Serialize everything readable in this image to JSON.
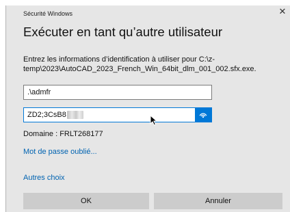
{
  "window": {
    "title": "Sécurité Windows",
    "close_glyph": "✕"
  },
  "dialog": {
    "heading": "Exécuter en tant qu’autre utilisateur",
    "description": "Entrez les informations d’identification à utiliser pour C:\\z-temp\\2023\\AutoCAD_2023_French_Win_64bit_dlm_001_002.sfx.exe."
  },
  "username_field": {
    "value": ".\\admfr"
  },
  "password_field": {
    "visible_value": "ZD2;3CsB8",
    "reveal_icon": "eye-reveal-icon"
  },
  "domain": {
    "text": "Domaine : FRLT268177"
  },
  "links": {
    "forgot_password": "Mot de passe oublié...",
    "more_choices": "Autres choix"
  },
  "buttons": {
    "ok": "OK",
    "cancel": "Annuler"
  },
  "colors": {
    "accent": "#0078d7",
    "link": "#0063b1",
    "dialog_bg": "#e6e6e6",
    "button_bg": "#cccccc"
  }
}
